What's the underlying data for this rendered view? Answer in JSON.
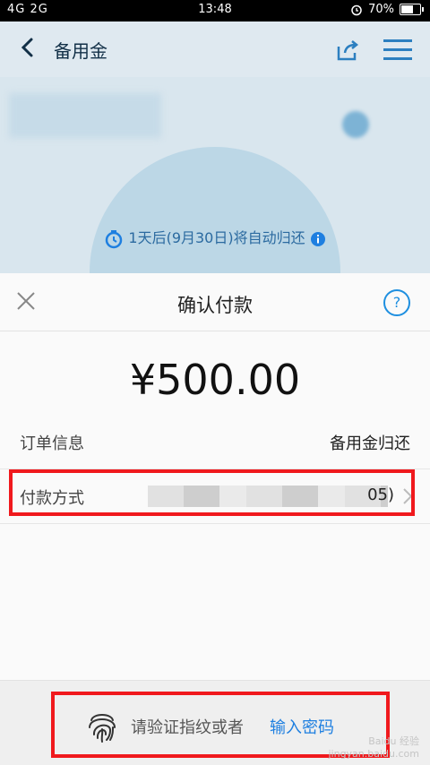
{
  "status": {
    "carrier": "4G  2G",
    "time": "13:48",
    "battery_text": "70%",
    "battery_level": 0.7
  },
  "background": {
    "title": "备用金",
    "notice": "1天后(9月30日)将自动归还"
  },
  "sheet": {
    "title": "确认付款",
    "amount": "¥500.00",
    "order_label": "订单信息",
    "order_value": "备用金归还",
    "pay_label": "付款方式",
    "pay_value_tail": "05)",
    "help_glyph": "?"
  },
  "bottom": {
    "prompt": "请验证指纹或者",
    "link": "输入密码",
    "watermark": "Baidu 经验\njingyan.baidu.com"
  },
  "colors": {
    "accent": "#1e7fe0",
    "highlight": "#f0191d"
  }
}
